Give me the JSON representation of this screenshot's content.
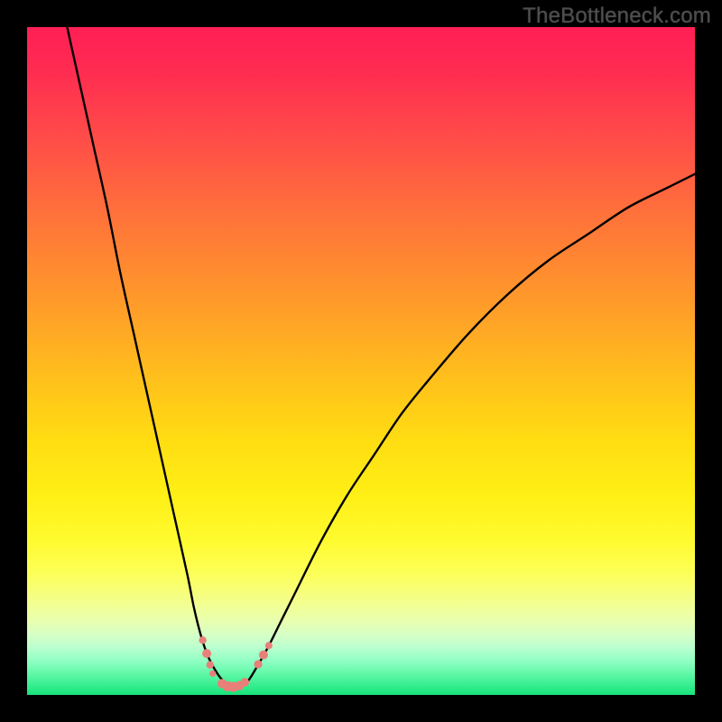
{
  "watermark": "TheBottleneck.com",
  "chart_data": {
    "type": "line",
    "title": "",
    "xlabel": "",
    "ylabel": "",
    "xlim": [
      0,
      100
    ],
    "ylim": [
      0,
      100
    ],
    "grid": false,
    "series": [
      {
        "name": "bottleneck-curve",
        "x": [
          6,
          8,
          10,
          12,
          14,
          16,
          18,
          20,
          22,
          24,
          25,
          26,
          27,
          28,
          29,
          30,
          30.5,
          31,
          32,
          33,
          34,
          36,
          38,
          40,
          44,
          48,
          52,
          56,
          60,
          66,
          72,
          78,
          84,
          90,
          96,
          100
        ],
        "y": [
          100,
          91,
          82,
          73,
          63,
          54,
          45,
          36,
          27,
          18,
          13,
          9,
          6,
          4,
          2.5,
          1.6,
          1.3,
          1.2,
          1.3,
          2,
          3.5,
          7,
          11,
          15,
          23,
          30,
          36,
          42,
          47,
          54,
          60,
          65,
          69,
          73,
          76,
          78
        ]
      },
      {
        "name": "markers-left-cluster",
        "x": [
          26.3,
          26.9,
          27.4,
          27.8
        ],
        "y": [
          8.2,
          6.2,
          4.5,
          3.2
        ],
        "r": [
          4.2,
          5.0,
          4.2,
          3.6
        ]
      },
      {
        "name": "markers-trough",
        "x": [
          29.2,
          30.0,
          30.9,
          31.8,
          32.6
        ],
        "y": [
          1.7,
          1.3,
          1.2,
          1.4,
          1.9
        ],
        "r": [
          5.2,
          5.6,
          5.6,
          5.2,
          4.8
        ]
      },
      {
        "name": "markers-right-cluster",
        "x": [
          34.6,
          35.4,
          36.2
        ],
        "y": [
          4.6,
          6.0,
          7.4
        ],
        "r": [
          4.6,
          5.0,
          4.0
        ]
      }
    ],
    "background_gradient_note": "vertical red→orange→yellow→green gradient indicates bottleneck severity (top=high, bottom=low); no explicit axis ticks or labels shown",
    "curve_note": "V-shaped curve dips to ~0 near x≈30–31%; minimum region marked with salmon dots"
  }
}
